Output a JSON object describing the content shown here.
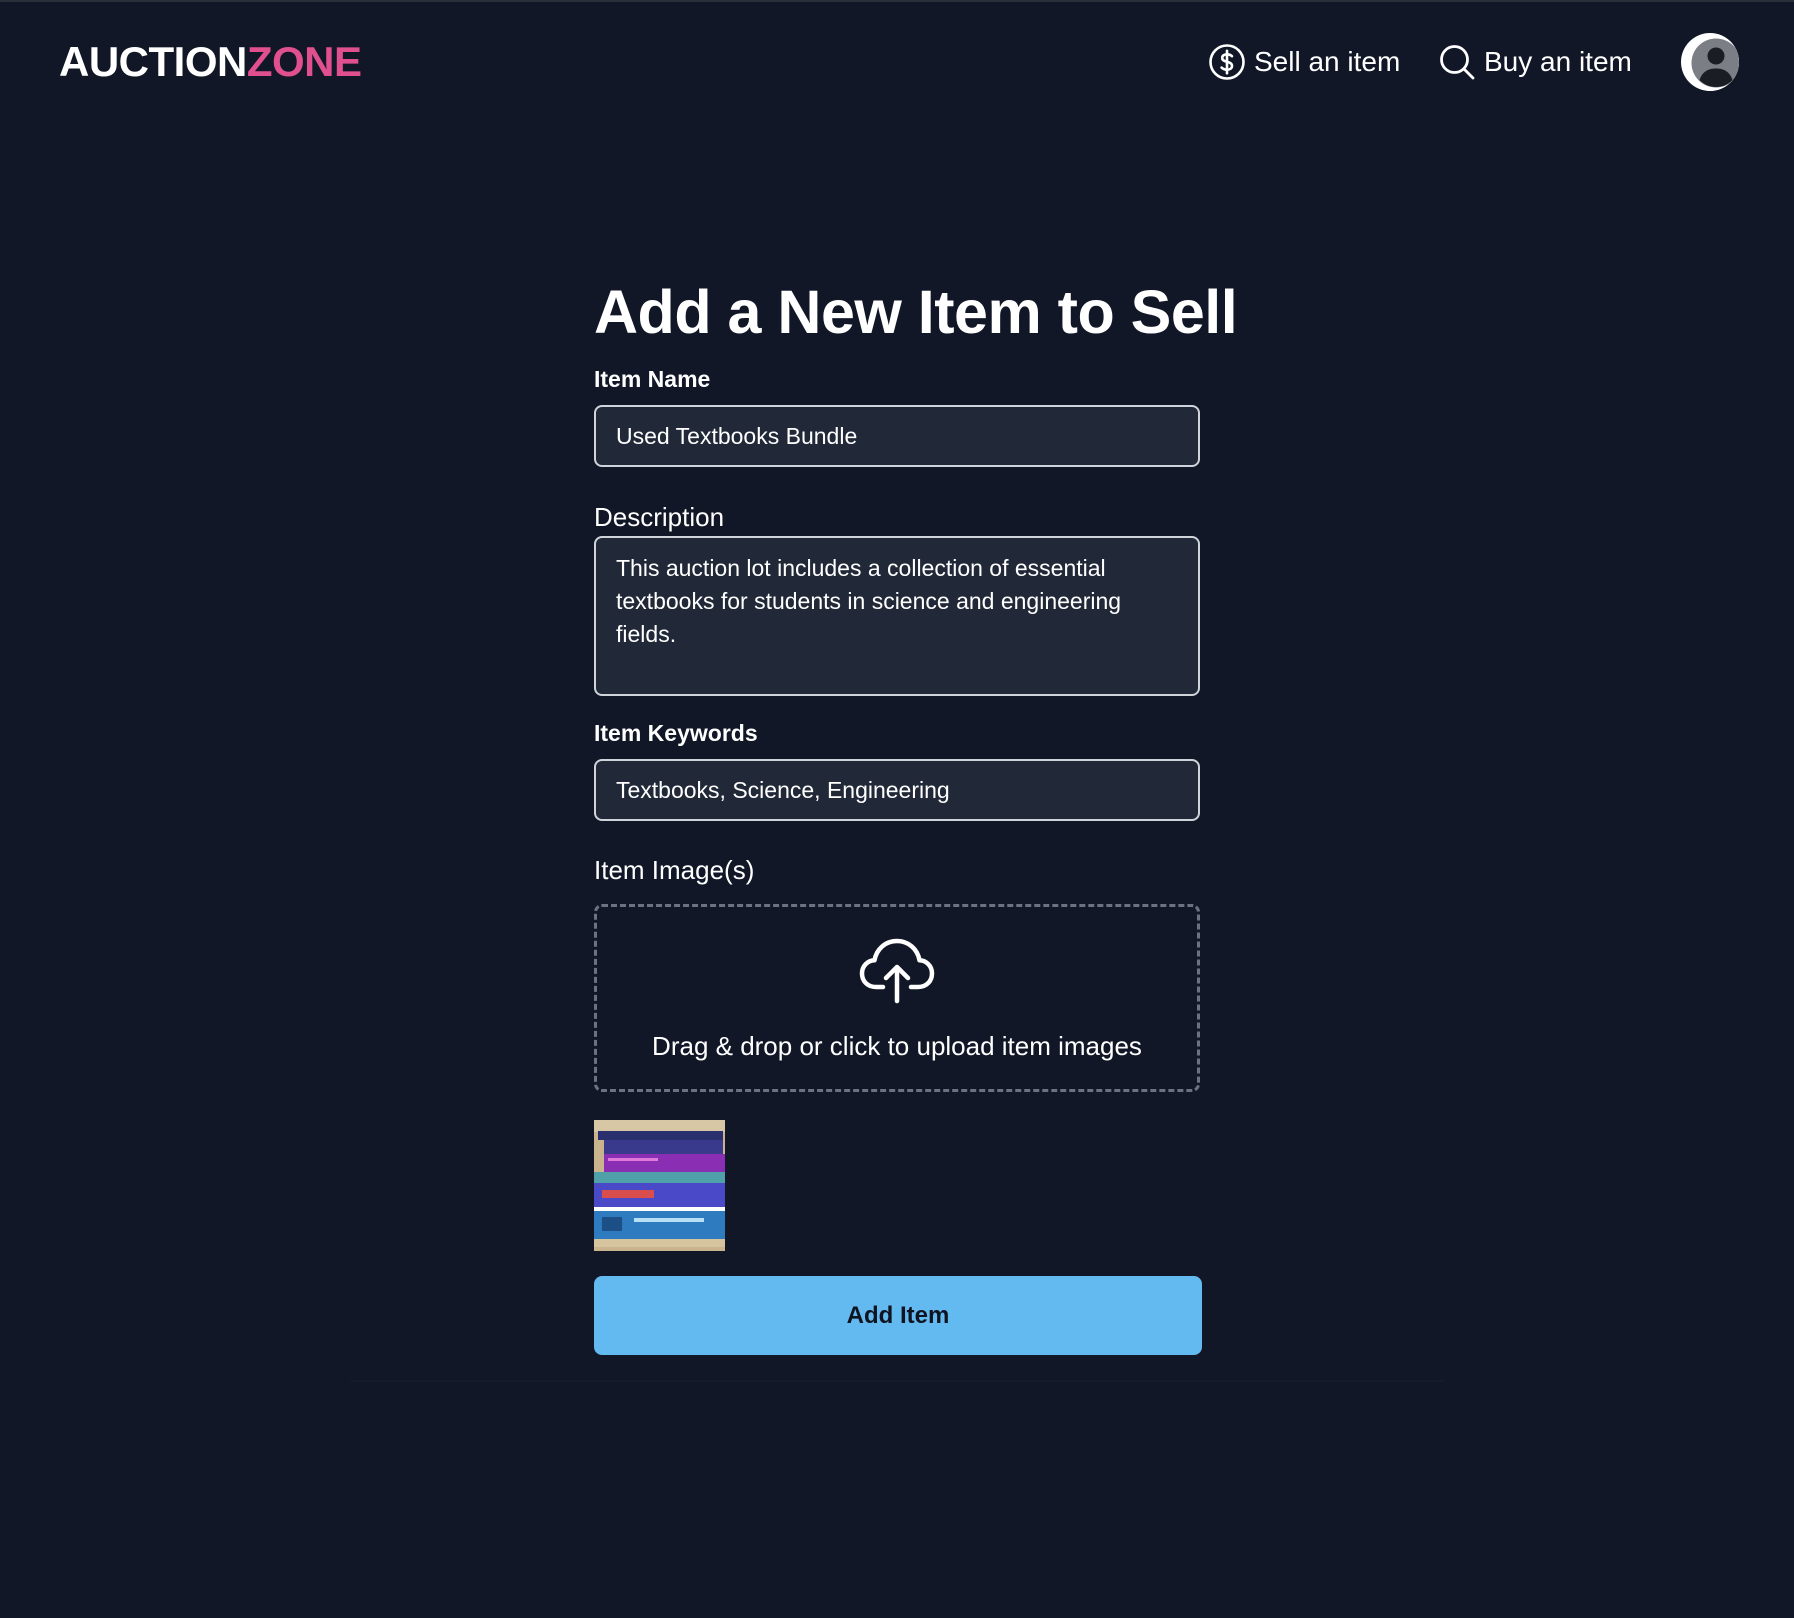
{
  "header": {
    "logo_part1": "AUCTION",
    "logo_part2": "ZONE",
    "nav": {
      "sell_label": "Sell an item",
      "buy_label": "Buy an item"
    },
    "icons": {
      "sell": "dollar-circle-icon",
      "buy": "search-icon",
      "profile": "user-avatar-icon"
    }
  },
  "form": {
    "title": "Add a New Item to Sell",
    "item_name": {
      "label": "Item Name",
      "value": "Used Textbooks Bundle"
    },
    "description": {
      "label": "Description",
      "value": "This auction lot includes a collection of essential textbooks for students in science and engineering fields."
    },
    "keywords": {
      "label": "Item Keywords",
      "value": "Textbooks, Science, Engineering"
    },
    "images": {
      "label": "Item Image(s)",
      "dropzone_text": "Drag & drop or click to upload item images",
      "dropzone_icon": "cloud-upload-icon",
      "uploaded_count": 1
    },
    "submit_label": "Add Item"
  },
  "colors": {
    "background": "#111727",
    "input_bg": "#212837",
    "accent_brand": "#e0508f",
    "button": "#63baf1"
  }
}
